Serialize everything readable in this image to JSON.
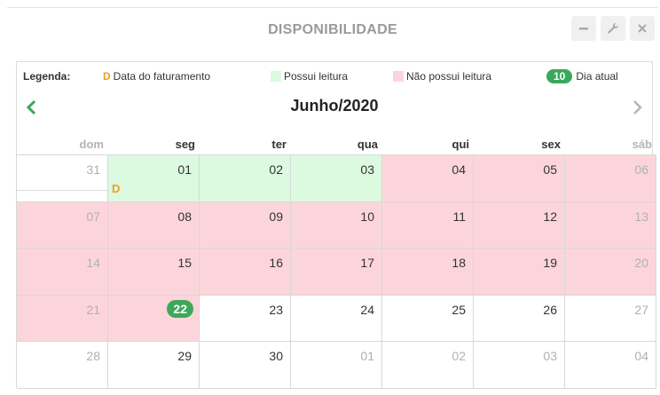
{
  "window": {
    "title": "DISPONIBILIDADE",
    "buttons": [
      {
        "name": "minimize",
        "icon": "minus-icon"
      },
      {
        "name": "settings",
        "icon": "wrench-icon"
      },
      {
        "name": "close",
        "icon": "close-icon"
      }
    ]
  },
  "legend": {
    "title": "Legenda:",
    "billing_marker": "D",
    "billing_label": "Data do faturamento",
    "has_reading_label": "Possui leitura",
    "no_reading_label": "Não possui leitura",
    "today_badge": "10",
    "today_label": "Dia atual",
    "colors": {
      "has_reading": "#dbfadf",
      "no_reading": "#fcd5db",
      "today": "#3aa85a",
      "billing": "#f0a020"
    }
  },
  "calendar": {
    "month_label": "Junho/2020",
    "prev_icon": "chevron-left-icon",
    "next_icon": "chevron-right-icon",
    "weekdays": [
      "dom",
      "seg",
      "ter",
      "qua",
      "qui",
      "sex",
      "sáb"
    ],
    "weeks": [
      [
        {
          "day": "31",
          "state": "none",
          "muted": true
        },
        {
          "day": "01",
          "state": "green",
          "billing": "D"
        },
        {
          "day": "02",
          "state": "green"
        },
        {
          "day": "03",
          "state": "green"
        },
        {
          "day": "04",
          "state": "red"
        },
        {
          "day": "05",
          "state": "red"
        },
        {
          "day": "06",
          "state": "red",
          "muted": true
        }
      ],
      [
        {
          "day": "07",
          "state": "red",
          "muted": true
        },
        {
          "day": "08",
          "state": "red"
        },
        {
          "day": "09",
          "state": "red"
        },
        {
          "day": "10",
          "state": "red"
        },
        {
          "day": "11",
          "state": "red"
        },
        {
          "day": "12",
          "state": "red"
        },
        {
          "day": "13",
          "state": "red",
          "muted": true
        }
      ],
      [
        {
          "day": "14",
          "state": "red",
          "muted": true
        },
        {
          "day": "15",
          "state": "red"
        },
        {
          "day": "16",
          "state": "red"
        },
        {
          "day": "17",
          "state": "red"
        },
        {
          "day": "18",
          "state": "red"
        },
        {
          "day": "19",
          "state": "red"
        },
        {
          "day": "20",
          "state": "red",
          "muted": true
        }
      ],
      [
        {
          "day": "21",
          "state": "red",
          "muted": true
        },
        {
          "day": "22",
          "state": "red",
          "today": true
        },
        {
          "day": "23",
          "state": "none"
        },
        {
          "day": "24",
          "state": "none"
        },
        {
          "day": "25",
          "state": "none"
        },
        {
          "day": "26",
          "state": "none"
        },
        {
          "day": "27",
          "state": "none",
          "muted": true
        }
      ],
      [
        {
          "day": "28",
          "state": "none",
          "muted": true
        },
        {
          "day": "29",
          "state": "none"
        },
        {
          "day": "30",
          "state": "none"
        },
        {
          "day": "01",
          "state": "none",
          "muted": true
        },
        {
          "day": "02",
          "state": "none",
          "muted": true
        },
        {
          "day": "03",
          "state": "none",
          "muted": true
        },
        {
          "day": "04",
          "state": "none",
          "muted": true
        }
      ]
    ]
  }
}
